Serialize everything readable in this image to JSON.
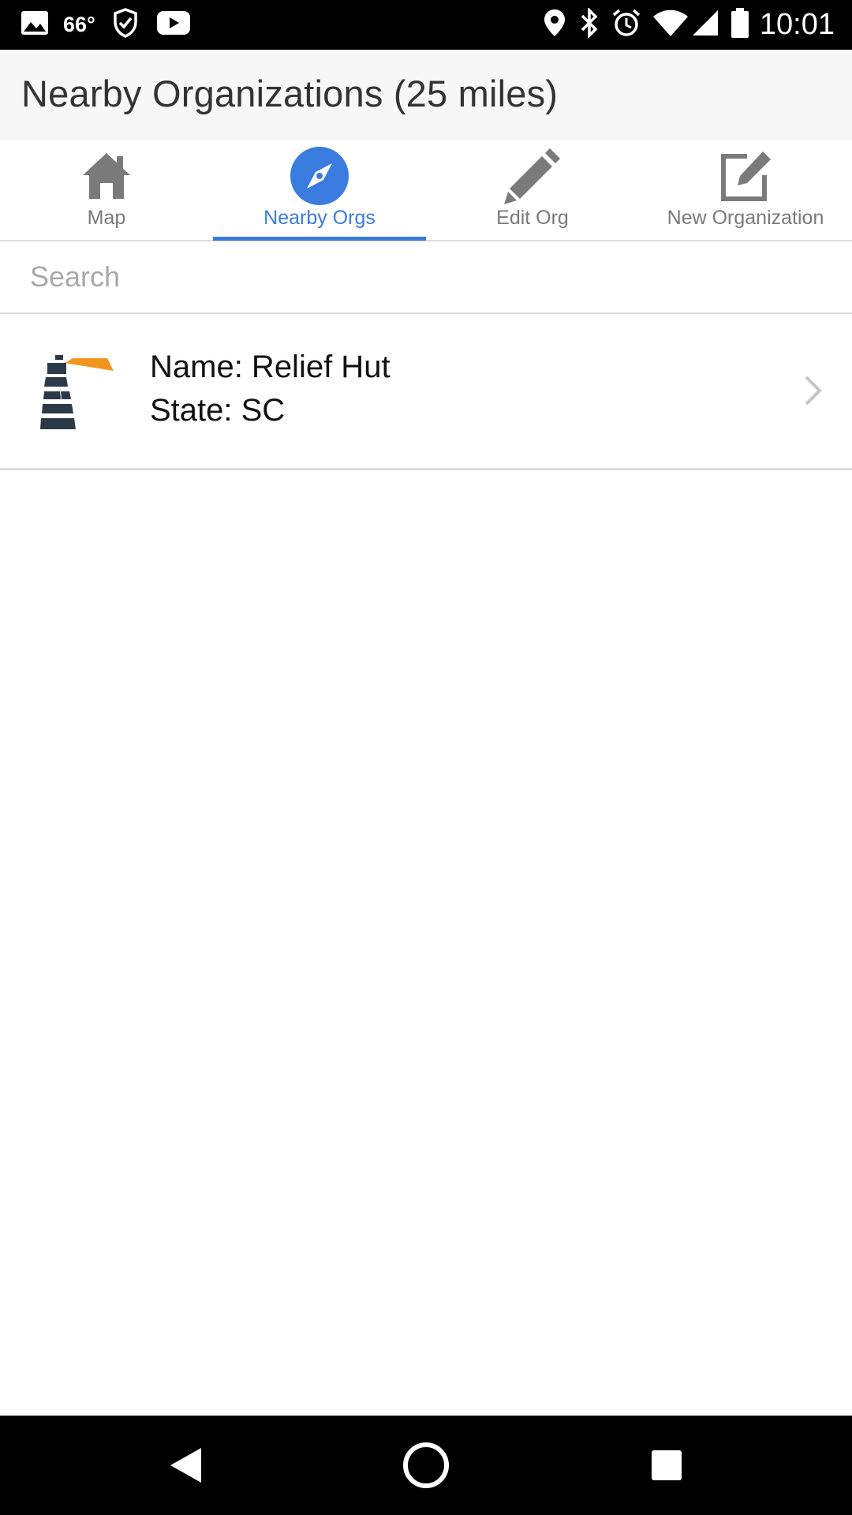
{
  "status_bar": {
    "temperature": "66°",
    "time": "10:01",
    "left_icons": [
      "image-icon",
      "shield-check-icon",
      "youtube-icon"
    ],
    "right_icons": [
      "location-icon",
      "bluetooth-icon",
      "alarm-icon",
      "wifi-icon",
      "signal-icon",
      "battery-icon"
    ]
  },
  "header": {
    "title": "Nearby Organizations (25 miles)"
  },
  "tabs": [
    {
      "label": "Map",
      "icon": "home-icon",
      "active": false
    },
    {
      "label": "Nearby Orgs",
      "icon": "compass-icon",
      "active": true
    },
    {
      "label": "Edit Org",
      "icon": "pencil-icon",
      "active": false
    },
    {
      "label": "New Organization",
      "icon": "edit-square-icon",
      "active": false
    }
  ],
  "search": {
    "placeholder": "Search",
    "value": ""
  },
  "organizations": [
    {
      "name_line": "Name: Relief Hut",
      "state_line": "State: SC",
      "logo": "lighthouse-logo"
    }
  ],
  "colors": {
    "accent": "#3a7be0",
    "tab_inactive": "#7a7a7a",
    "logo_dark": "#2b3a48",
    "logo_orange": "#f0961f",
    "header_bg": "#f7f7f7"
  },
  "nav_bar": {
    "buttons": [
      "back-icon",
      "home-circle-icon",
      "recents-icon"
    ]
  }
}
